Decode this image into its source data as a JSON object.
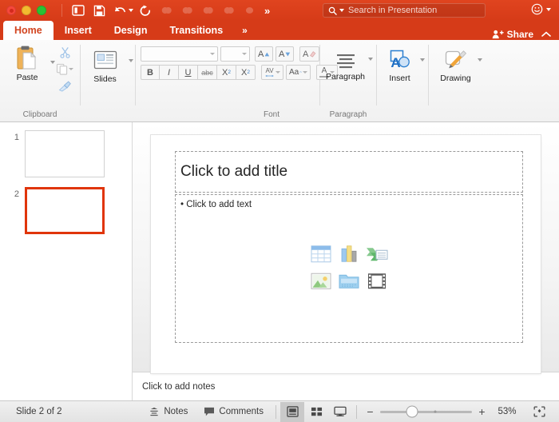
{
  "window": {
    "traffic_lights": [
      "close",
      "minimize",
      "maximize"
    ],
    "accent_red": "#d63b18",
    "quick_access": [
      {
        "name": "sidebar-toggle",
        "label": "Sidebar",
        "enabled": true
      },
      {
        "name": "save",
        "label": "Save",
        "enabled": true
      },
      {
        "name": "undo",
        "label": "Undo",
        "enabled": true
      },
      {
        "name": "redo",
        "label": "Redo",
        "enabled": true
      },
      {
        "name": "qat-extra-1",
        "label": "",
        "enabled": false
      },
      {
        "name": "qat-extra-2",
        "label": "",
        "enabled": false
      },
      {
        "name": "qat-extra-3",
        "label": "",
        "enabled": false
      },
      {
        "name": "qat-extra-4",
        "label": "",
        "enabled": false
      },
      {
        "name": "qat-extra-5",
        "label": "",
        "enabled": false
      }
    ],
    "overflow_label": "»",
    "search": {
      "placeholder": "Search in Presentation",
      "value": ""
    },
    "account_icon": "smiley-icon"
  },
  "ribbon": {
    "tabs": [
      {
        "label": "Home",
        "active": true
      },
      {
        "label": "Insert",
        "active": false
      },
      {
        "label": "Design",
        "active": false
      },
      {
        "label": "Transitions",
        "active": false
      }
    ],
    "tabs_overflow": "»",
    "share_label": "Share",
    "collapse_icon": "chevron-up-icon",
    "groups": {
      "clipboard": {
        "label": "Clipboard",
        "paste_label": "Paste",
        "cut_label": "Cut",
        "copy_label": "Copy",
        "format_painter_label": "Format Painter"
      },
      "slides": {
        "label": "",
        "slides_label": "Slides"
      },
      "font": {
        "label": "Font",
        "font_name": "",
        "font_name_placeholder": "",
        "font_size": "",
        "font_size_placeholder": "",
        "bold": "B",
        "italic": "I",
        "underline": "U",
        "strikethrough": "abc",
        "superscript": "X",
        "superscript_sup": "2",
        "subscript": "X",
        "subscript_sub": "2",
        "grow_font": "A",
        "shrink_font": "A",
        "clear_formatting": "A",
        "character_spacing": "AV",
        "change_case": "Aa",
        "font_color": "A"
      },
      "paragraph": {
        "label": "Paragraph",
        "button_label": "Paragraph"
      },
      "insert": {
        "label": "",
        "button_label": "Insert"
      },
      "drawing": {
        "label": "",
        "button_label": "Drawing"
      }
    }
  },
  "thumbnails": {
    "slides": [
      {
        "number": "1",
        "selected": false
      },
      {
        "number": "2",
        "selected": true
      }
    ]
  },
  "slide": {
    "title_placeholder": "Click to add title",
    "body_placeholder": "Click to add text",
    "body_bullet": "•",
    "content_icons": [
      {
        "name": "insert-table-icon",
        "label": "Insert Table"
      },
      {
        "name": "insert-chart-icon",
        "label": "Insert Chart"
      },
      {
        "name": "insert-smartart-icon",
        "label": "Insert SmartArt"
      },
      {
        "name": "insert-picture-icon",
        "label": "Insert Picture"
      },
      {
        "name": "picture-from-file-icon",
        "label": "Picture from File"
      },
      {
        "name": "insert-video-icon",
        "label": "Insert Video"
      }
    ]
  },
  "notes": {
    "placeholder": "Click to add notes",
    "value": ""
  },
  "status": {
    "slide_counter": "Slide 2 of 2",
    "notes_label": "Notes",
    "comments_label": "Comments",
    "views": [
      {
        "name": "normal-view",
        "active": true
      },
      {
        "name": "slide-sorter-view",
        "active": false
      },
      {
        "name": "slide-show-view",
        "active": false
      }
    ],
    "zoom_out": "−",
    "zoom_in": "+",
    "zoom_level": "53%",
    "fit_to_window": "fit-to-window-icon"
  }
}
